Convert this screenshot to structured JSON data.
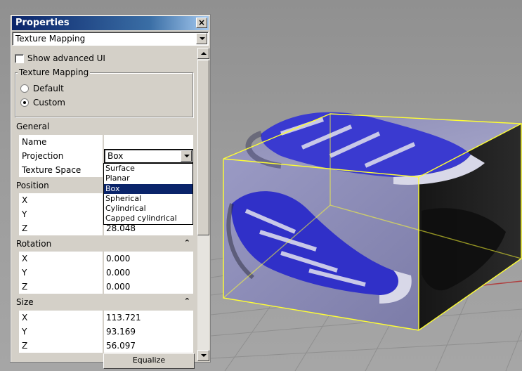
{
  "panel": {
    "title": "Properties",
    "close_glyph": "×",
    "top_combo_value": "Texture Mapping",
    "show_advanced_label": "Show advanced UI",
    "show_advanced_checked": false,
    "mapping_group_title": "Texture Mapping",
    "radio_default_label": "Default",
    "radio_custom_label": "Custom",
    "selected_mode": "Custom",
    "general": {
      "header": "General",
      "rows": [
        {
          "name": "Name",
          "value": ""
        },
        {
          "name": "Projection",
          "value": "Box"
        },
        {
          "name": "Texture Space",
          "value": ""
        }
      ]
    },
    "projection_options": [
      "Surface",
      "Planar",
      "Box",
      "Spherical",
      "Cylindrical",
      "Capped cylindrical"
    ],
    "projection_selected": "Box",
    "position": {
      "header": "Position",
      "rows": [
        {
          "name": "X",
          "value": ""
        },
        {
          "name": "Y",
          "value": ""
        },
        {
          "name": "Z",
          "value": "28.048"
        }
      ]
    },
    "rotation": {
      "header": "Rotation",
      "rows": [
        {
          "name": "X",
          "value": "0.000"
        },
        {
          "name": "Y",
          "value": "0.000"
        },
        {
          "name": "Z",
          "value": "0.000"
        }
      ]
    },
    "size": {
      "header": "Size",
      "rows": [
        {
          "name": "X",
          "value": "113.721"
        },
        {
          "name": "Y",
          "value": "93.169"
        },
        {
          "name": "Z",
          "value": "56.097"
        }
      ]
    },
    "equalize_label": "Equalize",
    "collapse_glyph": "⌃"
  },
  "colors": {
    "titlebar": "#0a246a",
    "selection": "#0a246a",
    "panel_bg": "#d4d0c8",
    "box_outline": "#ffff33",
    "shoe_blue": "#3a3ad0"
  },
  "icons": {
    "close": "close-icon",
    "dropdown": "chevron-down-icon",
    "collapse": "collapse-up-icon"
  }
}
